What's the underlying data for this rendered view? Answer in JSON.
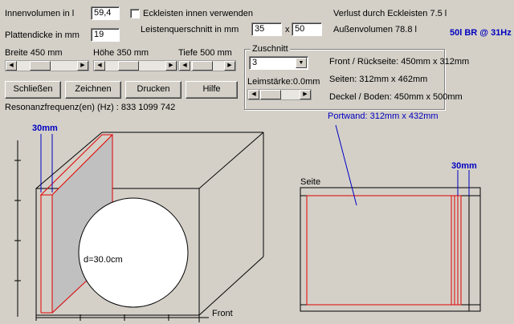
{
  "volume": {
    "label": "Innenvolumen in l",
    "value": "59,4"
  },
  "eckleisten": {
    "label": "Eckleisten innen verwenden"
  },
  "verlust": {
    "text": "Verlust durch Eckleisten 7.5 l"
  },
  "plattendicke": {
    "label": "Plattendicke in mm",
    "value": "19"
  },
  "leistenquerschnitt": {
    "label": "Leistenquerschnitt in mm",
    "value1": "35",
    "sep": "x",
    "value2": "50"
  },
  "aussenvolumen": {
    "text": "Außenvolumen 78.8 l"
  },
  "badge": {
    "text": "50l BR @ 31Hz"
  },
  "dims": {
    "breite": "Breite  450 mm",
    "hoehe": "Höhe  350 mm",
    "tiefe": "Tiefe  500 mm"
  },
  "buttons": {
    "schliessen": "Schließen",
    "zeichnen": "Zeichnen",
    "drucken": "Drucken",
    "hilfe": "Hilfe"
  },
  "resonanz": {
    "text": "Resonanzfrequenz(en) (Hz) :  833   1099    742"
  },
  "zuschnitt": {
    "legend": "Zuschnitt",
    "select_value": "3",
    "leimstaerke": "Leimstärke:0.0mm",
    "front": "Front / Rückseite: 450mm x 312mm",
    "seiten": "Seiten: 312mm x 462mm",
    "deckel": "Deckel / Boden: 450mm x 500mm"
  },
  "drawing": {
    "dim_left": "30mm",
    "diameter": "d=30.0cm",
    "front_label": "Front",
    "portwand": "Portwand: 312mm x 432mm",
    "seite_label": "Seite",
    "dim_right": "30mm"
  },
  "icons": {
    "scroll_left": "scroll-left-icon",
    "scroll_right": "scroll-right-icon",
    "dropdown": "chevron-down-icon"
  },
  "colors": {
    "background": "#d4d0c8",
    "accent_blue": "#0000c0",
    "port_red": "#e00000",
    "port_fill": "#c0c0c0"
  }
}
